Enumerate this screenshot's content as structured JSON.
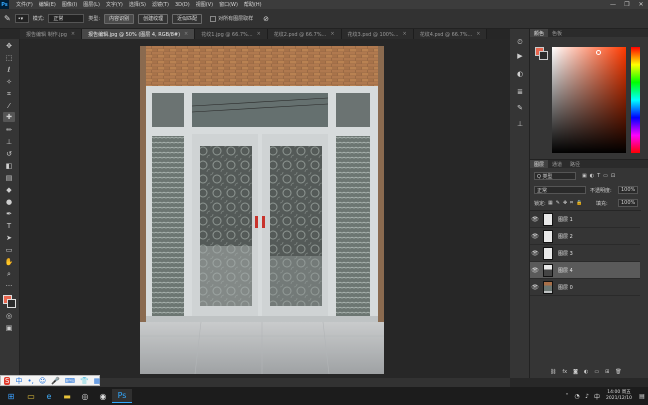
{
  "app": {
    "logo": "Ps"
  },
  "menu": [
    "文件(F)",
    "编辑(E)",
    "图像(I)",
    "图层(L)",
    "文字(Y)",
    "选择(S)",
    "滤镜(T)",
    "3D(D)",
    "视图(V)",
    "窗口(W)",
    "帮助(H)"
  ],
  "window_controls": {
    "minimize": "—",
    "maximize": "❐",
    "close": "✕"
  },
  "options": {
    "mode_label": "模式:",
    "mode_value": "正常",
    "type_label": "类型:",
    "content_aware": "内容识别",
    "create_texture": "创建纹理",
    "proximity": "近似匹配",
    "sample_all_layers": "对所有图层取样"
  },
  "tabs": [
    {
      "label": "报告编辑 制作.jpg",
      "active": false
    },
    {
      "label": "报告编辑.jpg @ 50% (图层 4, RGB/8#)",
      "active": true
    },
    {
      "label": "花纹1.jpg @ 66.7%...",
      "active": false
    },
    {
      "label": "花纹2.psd @ 66.7%...",
      "active": false
    },
    {
      "label": "花纹3.psd @ 100%...",
      "active": false
    },
    {
      "label": "花纹4.psd @ 66.7%...",
      "active": false
    }
  ],
  "color_panel": {
    "tabs": [
      "颜色",
      "色板"
    ]
  },
  "layers_panel": {
    "tabs": [
      "图层",
      "通道",
      "路径"
    ],
    "filter": "Q 类型",
    "blend_mode": "正常",
    "opacity_label": "不透明度:",
    "opacity_value": "100%",
    "lock_label": "锁定:",
    "fill_label": "填充:",
    "fill_value": "100%",
    "layers": [
      {
        "name": "图层 1",
        "selected": false
      },
      {
        "name": "图层 2",
        "selected": false
      },
      {
        "name": "图层 3",
        "selected": false
      },
      {
        "name": "图层 4",
        "selected": true
      },
      {
        "name": "图层 0",
        "selected": false
      }
    ]
  },
  "taskbar": {
    "time": "14:00 周五",
    "date": "2021/12/10"
  },
  "colors": {
    "foreground": "#e8664f",
    "background": "#2b2b2b",
    "accent": "#31a8ff"
  }
}
